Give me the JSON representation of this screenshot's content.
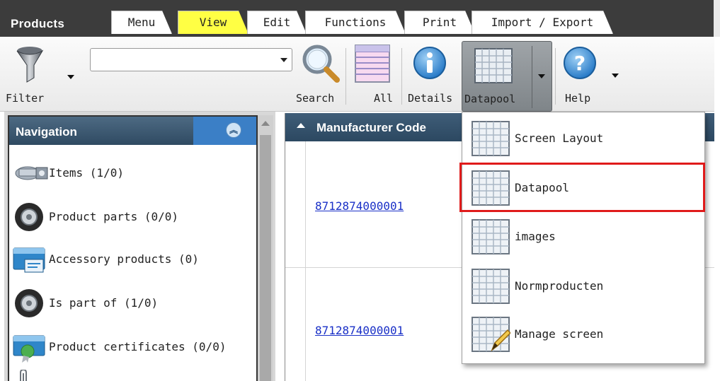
{
  "app": {
    "title": "Products"
  },
  "tabs": [
    {
      "label": "Menu"
    },
    {
      "label": "View",
      "active": true
    },
    {
      "label": "Edit"
    },
    {
      "label": "Functions"
    },
    {
      "label": "Print"
    },
    {
      "label": "Import / Export"
    }
  ],
  "toolbar": {
    "filter_label": "Filter",
    "filter_value": "",
    "search_label": "Search",
    "all_label": "All",
    "details_label": "Details",
    "datapool_label": "Datapool",
    "help_label": "Help"
  },
  "navigation": {
    "title": "Navigation",
    "items": [
      {
        "label": "Items (1/0)",
        "icon": "bolt-nut-icon"
      },
      {
        "label": "Product parts (0/0)",
        "icon": "tire-icon"
      },
      {
        "label": "Accessory products (0)",
        "icon": "accessory-box-icon"
      },
      {
        "label": "Is part of (1/0)",
        "icon": "tire-icon"
      },
      {
        "label": "Product certificates (0/0)",
        "icon": "certificate-icon"
      }
    ]
  },
  "grid": {
    "column": "Manufacturer Code",
    "rows": [
      {
        "code": "8712874000001"
      },
      {
        "code": "8712874000001"
      }
    ]
  },
  "datapool_menu": {
    "items": [
      {
        "label": "Screen Layout"
      },
      {
        "label": "Datapool",
        "highlighted": true
      },
      {
        "label": "images"
      },
      {
        "label": "Normproducten"
      },
      {
        "label": "Manage screen"
      }
    ]
  },
  "colors": {
    "tabbar_bg": "#3c3c3c",
    "active_tab": "#ffff44",
    "nav_header": "#2f4a62",
    "link": "#1a30c7",
    "highlight_border": "#e01b1b"
  }
}
